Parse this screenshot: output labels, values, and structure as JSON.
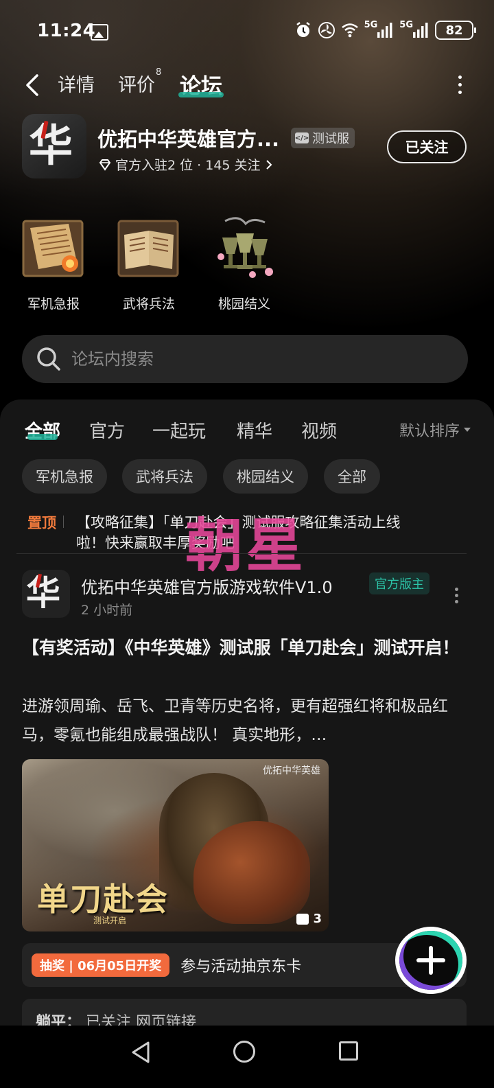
{
  "status_bar": {
    "time": "11:24",
    "network_1": "5G",
    "network_2": "5G",
    "battery": "82"
  },
  "nav": {
    "tabs": [
      {
        "label": "详情"
      },
      {
        "label": "评价",
        "badge": "8"
      },
      {
        "label": "论坛"
      }
    ],
    "active_tab": "论坛"
  },
  "app": {
    "logo_text": "华",
    "title": "优拓中华英雄官方...",
    "server_badge": "测试服",
    "stats": "官方入驻2 位 · 145 关注",
    "follow_button": "已关注"
  },
  "quick_sections": [
    {
      "label": "军机急报",
      "icon": "scroll-icon"
    },
    {
      "label": "武将兵法",
      "icon": "book-icon"
    },
    {
      "label": "桃园结义",
      "icon": "goblets-icon"
    }
  ],
  "search": {
    "placeholder": "论坛内搜索"
  },
  "feed_tabs": [
    "全部",
    "官方",
    "一起玩",
    "精华",
    "视频"
  ],
  "sort_label": "默认排序",
  "filter_chips": [
    "军机急报",
    "武将兵法",
    "桃园结义",
    "全部"
  ],
  "pinned": {
    "tag": "置顶",
    "text": "【攻略征集】「单刀赴会」测试服攻略征集活动上线啦！快来赢取丰厚奖励吧"
  },
  "watermark": "朝星",
  "post": {
    "author": "优拓中华英雄官方版游戏软件V1.0",
    "author_badge": "官方版主",
    "time": "2 小时前",
    "title": "【有奖活动】《中华英雄》测试服「单刀赴会」测试开启！",
    "body": "进游领周瑜、岳飞、卫青等历史名将，更有超强红将和极品红马，零氪也能组成最强战队！ 真实地形，…",
    "image_caption": "单刀赴会",
    "image_subcaption": "测试开启",
    "image_logo": "优拓中华英雄",
    "image_count": "3",
    "lottery_badge": "抽奖 | 06月05日开奖",
    "lottery_text": "参与活动抽京东卡"
  },
  "comment_preview": {
    "author": "躺平：",
    "text": "已关注 网页链接"
  },
  "colors": {
    "accent": "#20b39a",
    "pinned_tag": "#f07a3c",
    "lottery": "#f26a3d",
    "watermark": "#e8489a"
  }
}
